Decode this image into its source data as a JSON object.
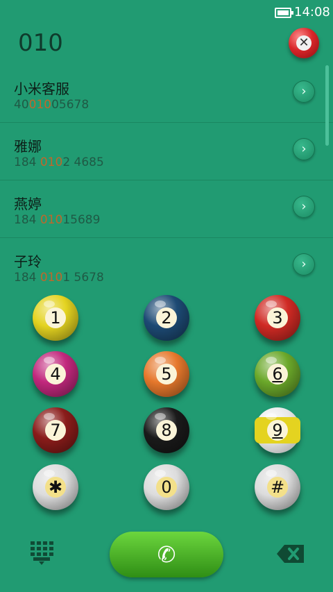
{
  "status": {
    "time": "14:08"
  },
  "dialed_number": "010",
  "contacts": [
    {
      "name": "小米客服",
      "number_pre": "40",
      "number_match": "010",
      "number_post": "05678"
    },
    {
      "name": "雅娜",
      "number_pre": "184 ",
      "number_match": "010",
      "number_post": "2 4685"
    },
    {
      "name": "燕婷",
      "number_pre": "184 ",
      "number_match": "010",
      "number_post": "15689"
    },
    {
      "name": "子玲",
      "number_pre": "184 ",
      "number_match": "010",
      "number_post": "1 5678"
    }
  ],
  "keys": [
    {
      "label": "1",
      "color": "#e4d320",
      "style": "solid"
    },
    {
      "label": "2",
      "color": "#1d4a74",
      "style": "solid"
    },
    {
      "label": "3",
      "color": "#d02a24",
      "style": "solid"
    },
    {
      "label": "4",
      "color": "#c2287d",
      "style": "solid"
    },
    {
      "label": "5",
      "color": "#e6782c",
      "style": "solid"
    },
    {
      "label": "6",
      "color": "#6ba82a",
      "style": "solid"
    },
    {
      "label": "7",
      "color": "#8a1c1a",
      "style": "solid"
    },
    {
      "label": "8",
      "color": "#1a1a1a",
      "style": "solid"
    },
    {
      "label": "9",
      "color": "#e4d320",
      "style": "stripe"
    },
    {
      "label": "✱",
      "color": "#dcdcdc",
      "style": "white"
    },
    {
      "label": "0",
      "color": "#dcdcdc",
      "style": "white"
    },
    {
      "label": "#",
      "color": "#dcdcdc",
      "style": "white"
    }
  ],
  "icons": {
    "battery": "battery-icon",
    "clear": "close-icon",
    "contact_arrow": "chevron-right-icon",
    "dialpad": "dialpad-icon",
    "call": "phone-icon",
    "backspace": "backspace-icon"
  },
  "colors": {
    "background": "#219b72",
    "highlight": "#c0672a",
    "call": "#4bb12a"
  }
}
